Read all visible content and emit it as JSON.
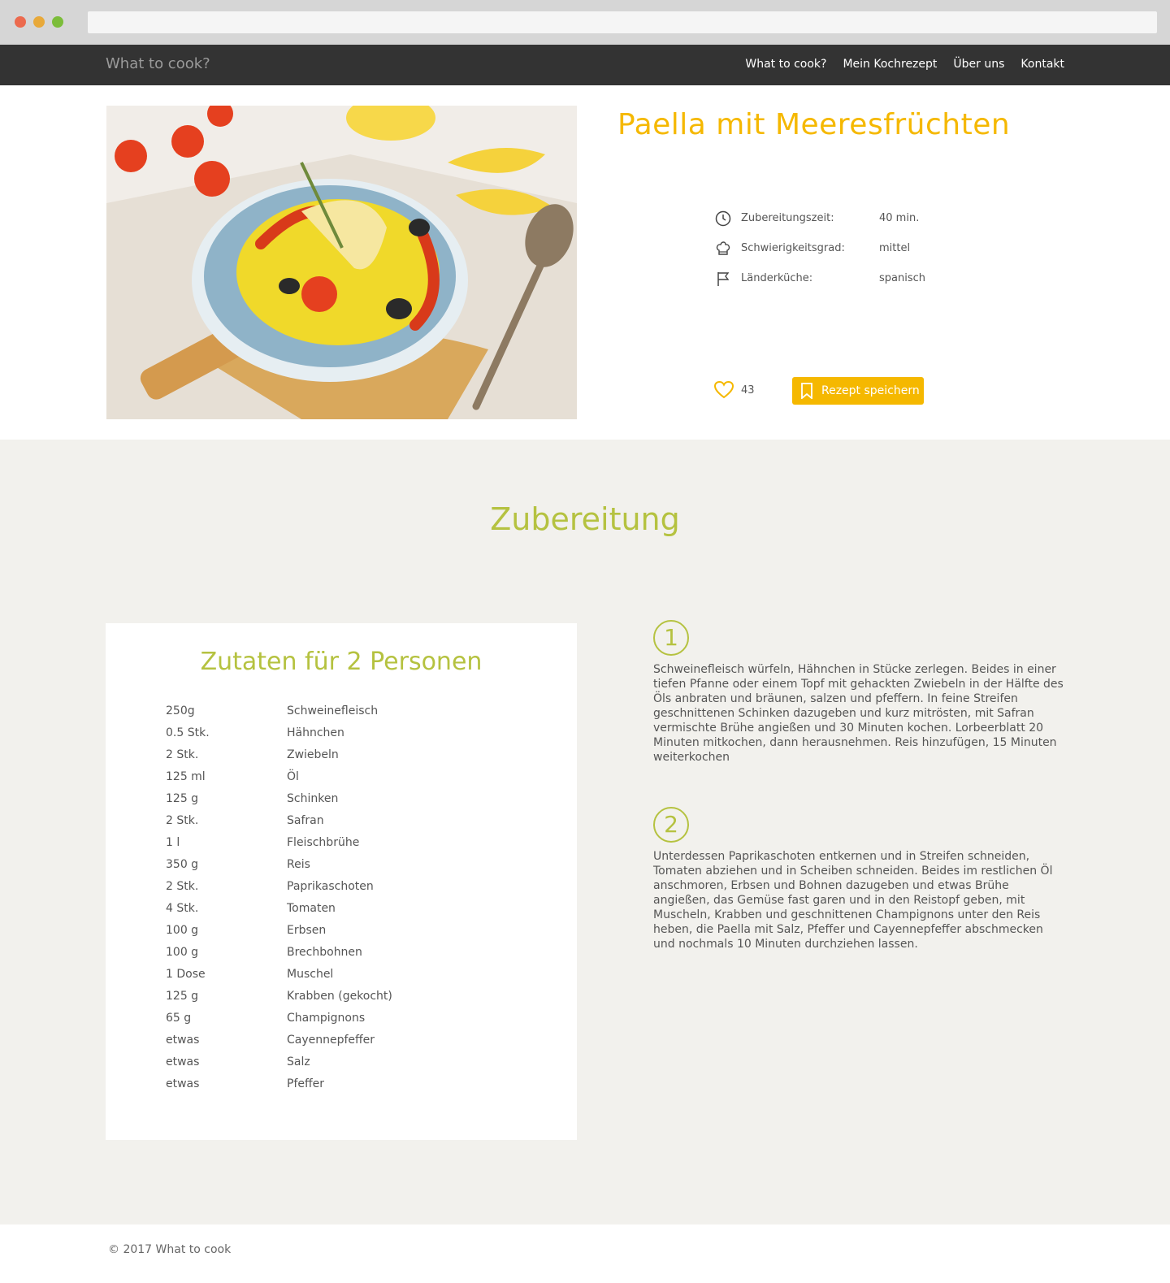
{
  "browser": {
    "address": ""
  },
  "navbar": {
    "brand": "What to cook?",
    "links": [
      "What to cook?",
      "Mein Kochrezept",
      "Über uns",
      "Kontakt"
    ]
  },
  "recipe": {
    "title": "Paella mit Meeresfrüchten",
    "image_alt": "Paella",
    "info": [
      {
        "icon": "clock-icon",
        "label": "Zubereitungszeit:",
        "value": "40 min."
      },
      {
        "icon": "chef-hat-icon",
        "label": "Schwierigkeitsgrad:",
        "value": "mittel"
      },
      {
        "icon": "flag-icon",
        "label": "Länderküche:",
        "value": "spanisch"
      }
    ],
    "likes": "43",
    "save_label": "Rezept speichern"
  },
  "preparation": {
    "title": "Zubereitung",
    "ingredients_title": "Zutaten für 2 Personen",
    "ingredients": [
      {
        "qty": "250g",
        "name": "Schweinefleisch"
      },
      {
        "qty": "0.5 Stk.",
        "name": "Hähnchen"
      },
      {
        "qty": "2 Stk.",
        "name": "Zwiebeln"
      },
      {
        "qty": "125 ml",
        "name": "Öl"
      },
      {
        "qty": "125 g",
        "name": "Schinken"
      },
      {
        "qty": "2 Stk.",
        "name": "Safran"
      },
      {
        "qty": "1 l",
        "name": "Fleischbrühe"
      },
      {
        "qty": "350 g",
        "name": "Reis"
      },
      {
        "qty": "2 Stk.",
        "name": "Paprikaschoten"
      },
      {
        "qty": "4 Stk.",
        "name": "Tomaten"
      },
      {
        "qty": "100 g",
        "name": "Erbsen"
      },
      {
        "qty": "100 g",
        "name": "Brechbohnen"
      },
      {
        "qty": "1 Dose",
        "name": "Muschel"
      },
      {
        "qty": "125 g",
        "name": "Krabben (gekocht)"
      },
      {
        "qty": "65 g",
        "name": "Champignons"
      },
      {
        "qty": "etwas",
        "name": "Cayennepfeffer"
      },
      {
        "qty": "etwas",
        "name": "Salz"
      },
      {
        "qty": "etwas",
        "name": "Pfeffer"
      }
    ],
    "steps": [
      {
        "num": "1",
        "text": "Schweinefleisch würfeln, Hähnchen in Stücke zerlegen. Beides in einer tiefen Pfanne oder einem Topf mit gehackten Zwiebeln in der Hälfte des Öls anbraten und bräunen, salzen und pfeffern. In feine Streifen geschnittenen Schinken dazugeben und kurz mitrösten, mit Safran vermischte Brühe angießen und 30 Minuten kochen. Lorbeerblatt 20 Minuten mitkochen, dann herausnehmen. Reis hinzufügen, 15 Minuten weiterkochen"
      },
      {
        "num": "2",
        "text": "Unterdessen Paprikaschoten entkernen und in Streifen schneiden, Tomaten abziehen und in Scheiben schneiden. Beides im restlichen Öl anschmoren, Erbsen und Bohnen dazugeben und etwas Brühe angießen, das Gemüse fast garen und in den Reistopf geben, mit Muscheln, Krabben und geschnittenen Champignons unter den Reis heben, die Paella mit Salz, Pfeffer und Cayennepfeffer abschmecken und nochmals 10 Minuten durchziehen lassen."
      }
    ]
  },
  "footer": {
    "copyright": "© 2017 What to cook"
  },
  "colors": {
    "accent_yellow": "#f5b800",
    "accent_green": "#b5c240",
    "nav_bg": "#333333",
    "section_bg": "#f2f1ed"
  }
}
